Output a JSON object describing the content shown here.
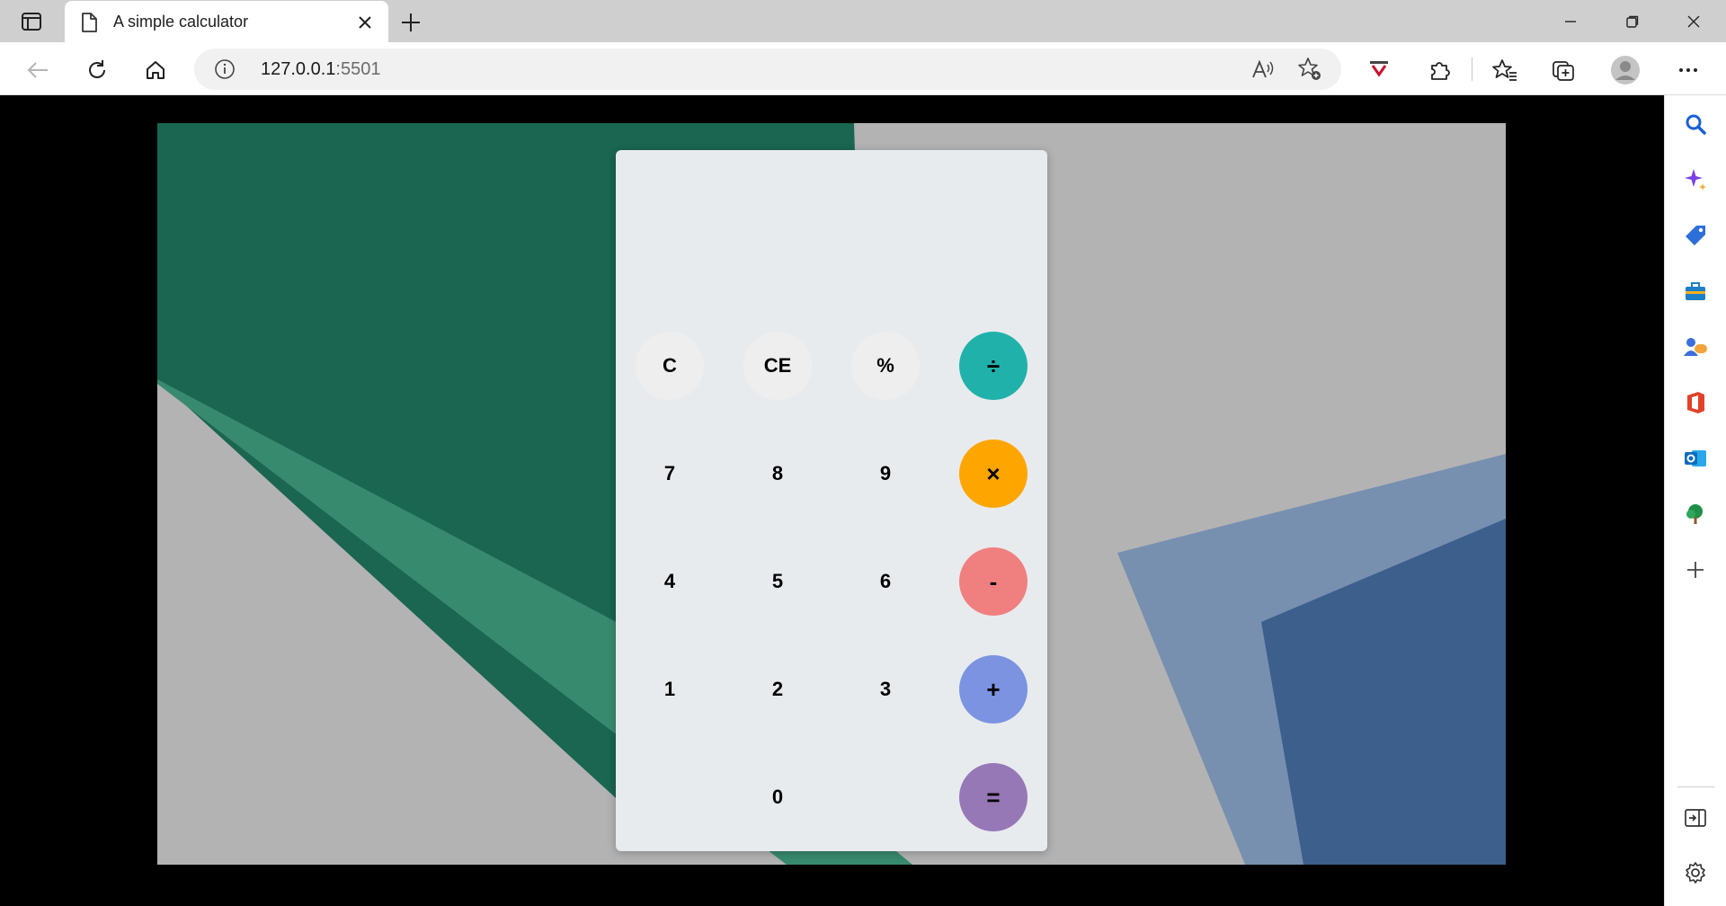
{
  "browser": {
    "tab": {
      "title": "A simple calculator"
    },
    "address": {
      "host": "127.0.0.1",
      "port": ":5501"
    }
  },
  "calculator": {
    "display": "",
    "rows": [
      [
        {
          "label": "C",
          "kind": "light",
          "name": "clear-button"
        },
        {
          "label": "CE",
          "kind": "light",
          "name": "clear-entry-button"
        },
        {
          "label": "%",
          "kind": "light",
          "name": "percent-button"
        },
        {
          "label": "÷",
          "kind": "op",
          "color": "#20b2aa",
          "name": "divide-button"
        }
      ],
      [
        {
          "label": "7",
          "kind": "num",
          "name": "digit-7-button"
        },
        {
          "label": "8",
          "kind": "num",
          "name": "digit-8-button"
        },
        {
          "label": "9",
          "kind": "num",
          "name": "digit-9-button"
        },
        {
          "label": "×",
          "kind": "op",
          "color": "#ffa500",
          "name": "multiply-button"
        }
      ],
      [
        {
          "label": "4",
          "kind": "num",
          "name": "digit-4-button"
        },
        {
          "label": "5",
          "kind": "num",
          "name": "digit-5-button"
        },
        {
          "label": "6",
          "kind": "num",
          "name": "digit-6-button"
        },
        {
          "label": "-",
          "kind": "op",
          "color": "#f08080",
          "name": "subtract-button"
        }
      ],
      [
        {
          "label": "1",
          "kind": "num",
          "name": "digit-1-button"
        },
        {
          "label": "2",
          "kind": "num",
          "name": "digit-2-button"
        },
        {
          "label": "3",
          "kind": "num",
          "name": "digit-3-button"
        },
        {
          "label": "+",
          "kind": "op",
          "color": "#7b93e0",
          "name": "add-button"
        }
      ],
      [
        null,
        {
          "label": "0",
          "kind": "num",
          "name": "digit-0-button"
        },
        null,
        {
          "label": "=",
          "kind": "op",
          "color": "#9678b6",
          "name": "equals-button"
        }
      ]
    ]
  },
  "sidebar": {
    "items": [
      {
        "icon": "search-icon",
        "color": "#1a5fd6"
      },
      {
        "icon": "copilot-sparkle-icon",
        "color": "#7b3fe4"
      },
      {
        "icon": "shopping-tag-icon",
        "color": "#2d6fd8"
      },
      {
        "icon": "tools-briefcase-icon",
        "color": "#1d7fc6"
      },
      {
        "icon": "games-icon",
        "color": "#3a6ed8"
      },
      {
        "icon": "office-icon",
        "color": "#e2412a"
      },
      {
        "icon": "outlook-icon",
        "color": "#0f6cbd"
      },
      {
        "icon": "tree-icon",
        "color": "#1f8f4a"
      },
      {
        "icon": "add-icon",
        "color": "#444444"
      }
    ]
  }
}
